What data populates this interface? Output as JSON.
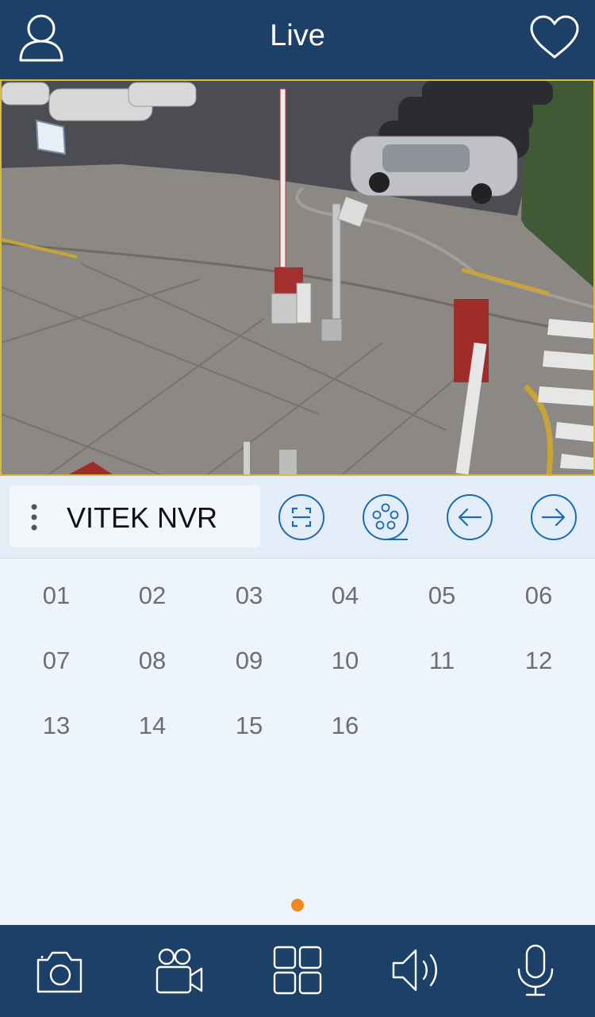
{
  "header": {
    "title": "Live"
  },
  "device": {
    "name": "VITEK NVR"
  },
  "channels": [
    "01",
    "02",
    "03",
    "04",
    "05",
    "06",
    "07",
    "08",
    "09",
    "10",
    "11",
    "12",
    "13",
    "14",
    "15",
    "16"
  ],
  "pagination": {
    "pages": 1,
    "current": 1
  },
  "colors": {
    "primary": "#1c4068",
    "background": "#eef4fb",
    "accent": "#f08a1c",
    "icon_blue": "#1a6bb4",
    "video_border": "#d8bb3a"
  },
  "icons": {
    "header": [
      "user-icon",
      "heart-icon"
    ],
    "toolbar": [
      "fullscreen-icon",
      "film-reel-icon",
      "arrow-left-icon",
      "arrow-right-icon"
    ],
    "bottom": [
      "camera-icon",
      "video-camera-icon",
      "grid-icon",
      "speaker-icon",
      "microphone-icon"
    ]
  }
}
